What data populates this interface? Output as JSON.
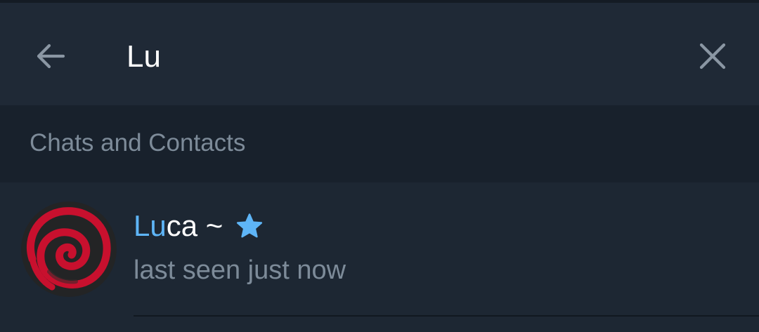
{
  "search": {
    "value": "Lu",
    "placeholder": ""
  },
  "section": {
    "title": "Chats and Contacts"
  },
  "results": [
    {
      "name_match": "Lu",
      "name_rest": "ca ~",
      "status": "last seen just now",
      "badge_icon": "star-icon"
    }
  ],
  "icons": {
    "back": "arrow-left-icon",
    "clear": "close-icon",
    "avatar": "debian-swirl-avatar"
  },
  "colors": {
    "background": "#1d2733",
    "header_background": "#1f2936",
    "section_background": "#18212c",
    "accent": "#5eb5f7",
    "secondary_text": "#7d8b99",
    "avatar_red": "#c8102e"
  }
}
